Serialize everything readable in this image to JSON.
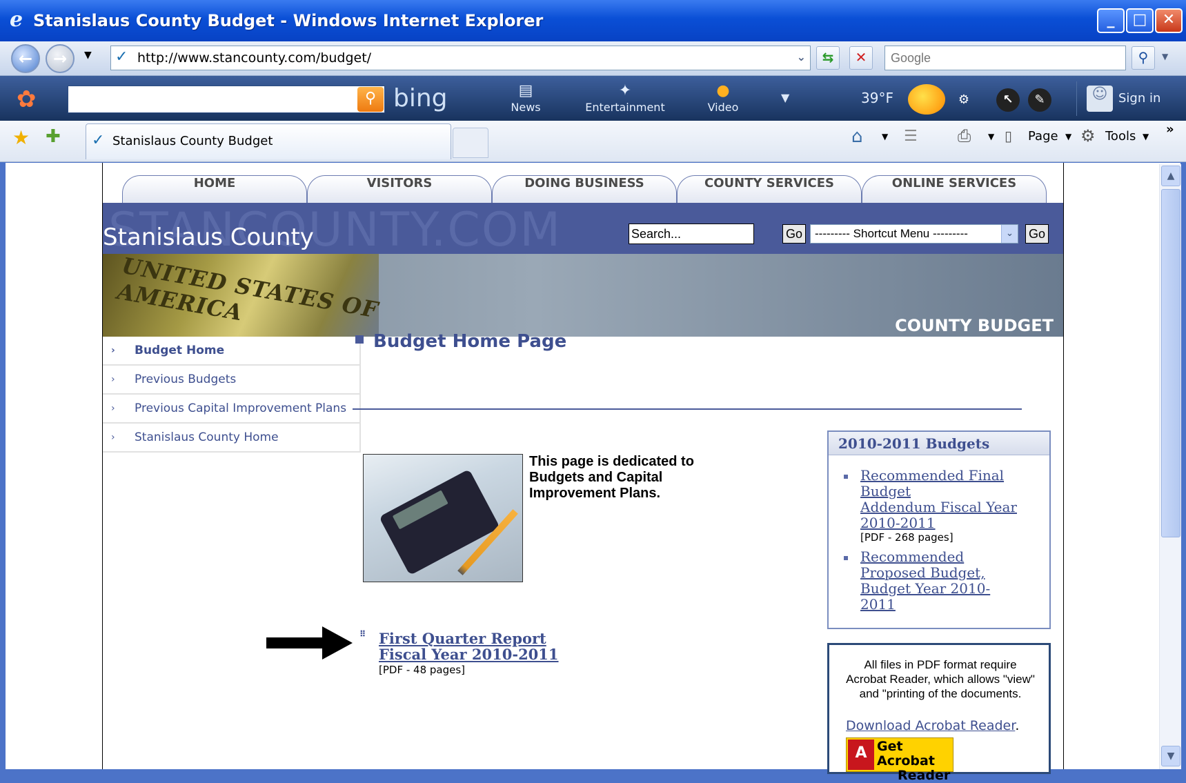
{
  "window": {
    "title": "Stanislaus County Budget - Windows Internet Explorer",
    "minimize": "_",
    "maximize": "□",
    "close": "✕"
  },
  "navbar": {
    "url": "http://www.stancounty.com/budget/",
    "search_placeholder": "Google"
  },
  "bingbar": {
    "logo": "bing",
    "items": [
      {
        "label": "News",
        "icon": "news-icon"
      },
      {
        "label": "Entertainment",
        "icon": "entertainment-icon"
      },
      {
        "label": "Video",
        "icon": "video-icon"
      }
    ],
    "temperature": "39°F",
    "signin": "Sign in"
  },
  "tabs": {
    "active_label": "Stanislaus County Budget",
    "commands": {
      "page": "Page",
      "tools": "Tools"
    }
  },
  "site": {
    "nav_tabs": [
      "HOME",
      "VISITORS",
      "DOING BUSINESS",
      "COUNTY SERVICES",
      "ONLINE SERVICES"
    ],
    "watermark": "STANCOUNTY.COM",
    "name": "Stanislaus County",
    "search_placeholder": "Search...",
    "go": "Go",
    "shortcut_menu": "--------- Shortcut Menu ---------",
    "money_text": "UNITED STATES OF AMERICA",
    "section_title": "COUNTY BUDGET",
    "left_nav": [
      {
        "label": "Budget Home"
      },
      {
        "label": "Previous Budgets"
      },
      {
        "label": "Previous Capital Improvement Plans"
      },
      {
        "label": "Stanislaus County Home"
      }
    ],
    "page_title": "Budget Home Page",
    "intro": "This page is dedicated to Budgets and Capital Improvement Plans.",
    "first_quarter": {
      "line1": "First Quarter Report",
      "line2": "Fiscal Year 2010-2011",
      "note": "[PDF - 48 pages]"
    },
    "budgets_box": {
      "title": "2010-2011 Budgets",
      "item1": {
        "lines": [
          "Recommended Final",
          "Budget",
          "Addendum Fiscal Year",
          "2010-2011"
        ],
        "note": "[PDF - 268 pages]"
      },
      "item2": {
        "lines": [
          "Recommended",
          "Proposed Budget,",
          "Budget Year 2010-",
          "2011"
        ]
      }
    },
    "acrobat_box": {
      "text": "All files in PDF format require Acrobat Reader, which allows \"view\" and \"printing of the documents.",
      "link": "Download Acrobat Reader",
      "link_suffix": ".",
      "badge_line1": "Get Acrobat",
      "badge_line2": "Reader"
    }
  }
}
